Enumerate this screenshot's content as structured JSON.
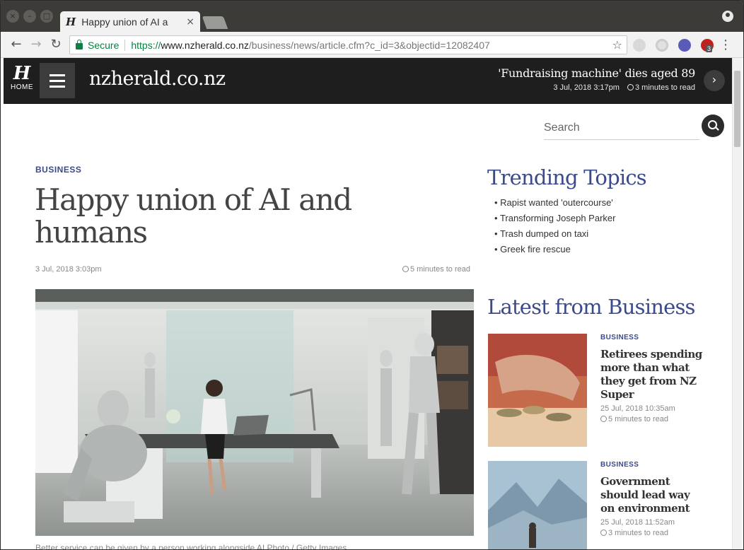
{
  "browser": {
    "tab_title": "Happy union of AI a",
    "tab_close": "×",
    "secure_label": "Secure",
    "url_scheme": "https://",
    "url_host": "www.nzherald.co.nz",
    "url_path": "/business/news/article.cfm?c_id=3&objectid=12082407",
    "ext_badge": "3"
  },
  "site": {
    "home_label": "HOME",
    "logo_glyph": "H",
    "name": "nzherald.co.nz",
    "header_story": {
      "title": "'Fundraising machine' dies aged 89",
      "date": "3 Jul, 2018 3:17pm",
      "read_time": "3 minutes to read"
    }
  },
  "search": {
    "placeholder": "Search"
  },
  "article": {
    "section": "BUSINESS",
    "title": "Happy union of AI and humans",
    "date": "3 Jul, 2018 3:03pm",
    "read_time": "5 minutes to read",
    "caption": "Better service can be given by a person working alongside AI.Photo / Getty Images"
  },
  "trending": {
    "title": "Trending Topics",
    "items": [
      "Rapist wanted 'outercourse'",
      "Transforming Joseph Parker",
      "Trash dumped on taxi",
      "Greek fire rescue"
    ]
  },
  "latest": {
    "title": "Latest from Business",
    "stories": [
      {
        "section": "BUSINESS",
        "headline": "Retirees spending more than what they get from NZ Super",
        "date": "25 Jul, 2018 10:35am",
        "read_time": "5 minutes to read"
      },
      {
        "section": "BUSINESS",
        "headline": "Government should lead way on environment",
        "date": "25 Jul, 2018 11:52am",
        "read_time": "3 minutes to read"
      }
    ]
  },
  "colors": {
    "accent": "#3b4a8a",
    "header_bg": "#1e1e1e",
    "secure": "#0b8043"
  }
}
